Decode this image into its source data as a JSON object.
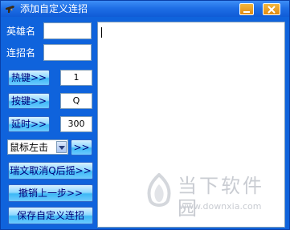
{
  "window": {
    "title": "添加自定义连招",
    "app_icon": "gun-icon",
    "controls": {
      "minimize_icon": "minimize-icon",
      "close_icon": "close-icon"
    }
  },
  "form": {
    "hero_label": "英雄名",
    "hero_value": "",
    "combo_label": "连招名",
    "combo_value": ""
  },
  "rows": {
    "hotkey_button": "热键>>",
    "hotkey_value": "1",
    "key_button": "按键>>",
    "key_value": "Q",
    "delay_button": "延时>>",
    "delay_value": "300"
  },
  "mouse": {
    "selected": "鼠标左击",
    "add_button": ">>"
  },
  "actions": {
    "cancel_swing": "瑞文取消Q后摇>>",
    "undo": "撤销上一步>>",
    "save": "保存自定义连招"
  },
  "editor": {
    "content": ""
  },
  "watermark": {
    "text": "当下软件园",
    "url": "www.downxia.com"
  }
}
